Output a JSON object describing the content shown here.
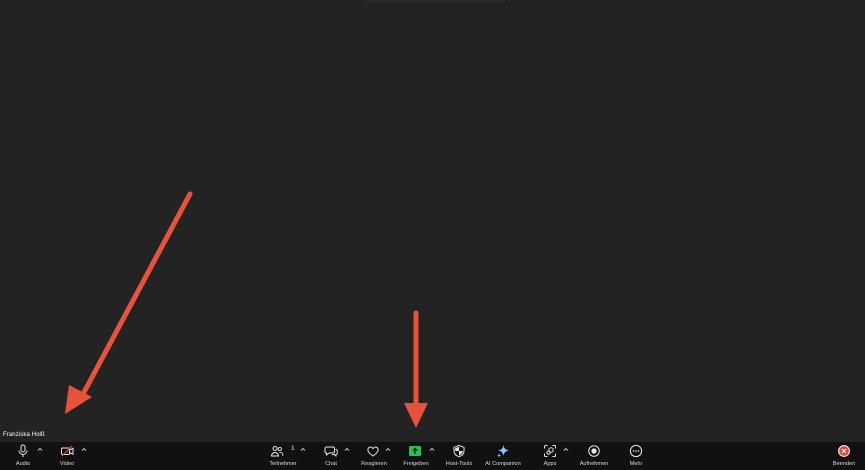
{
  "participant": {
    "name": "Franziska Holß"
  },
  "toolbar": {
    "audio_label": "Audio",
    "video_label": "Video",
    "participants_label": "Teilnehmer",
    "participants_count": "1",
    "chat_label": "Chat",
    "react_label": "Reagieren",
    "share_label": "Freigeben",
    "host_tools_label": "Host-Tools",
    "ai_companion_label": "AI Companion",
    "apps_label": "Apps",
    "record_label": "Aufnehmen",
    "more_label": "Mehr",
    "end_label": "Beenden"
  },
  "icons": {
    "audio": "microphone-icon",
    "video": "video-off-icon",
    "participants": "people-icon",
    "chat": "chat-bubbles-icon",
    "react": "heart-icon",
    "share": "share-screen-icon",
    "host_tools": "shield-icon",
    "ai_companion": "sparkle-icon",
    "apps": "apps-icon",
    "record": "record-icon",
    "more": "more-dots-icon",
    "end": "end-x-icon"
  },
  "colors": {
    "background": "#232323",
    "toolbar": "#111111",
    "share_accent": "#25c35b",
    "video_off": "#e0463f",
    "end": "#e0463f",
    "annotation_arrow": "#e8523a"
  }
}
